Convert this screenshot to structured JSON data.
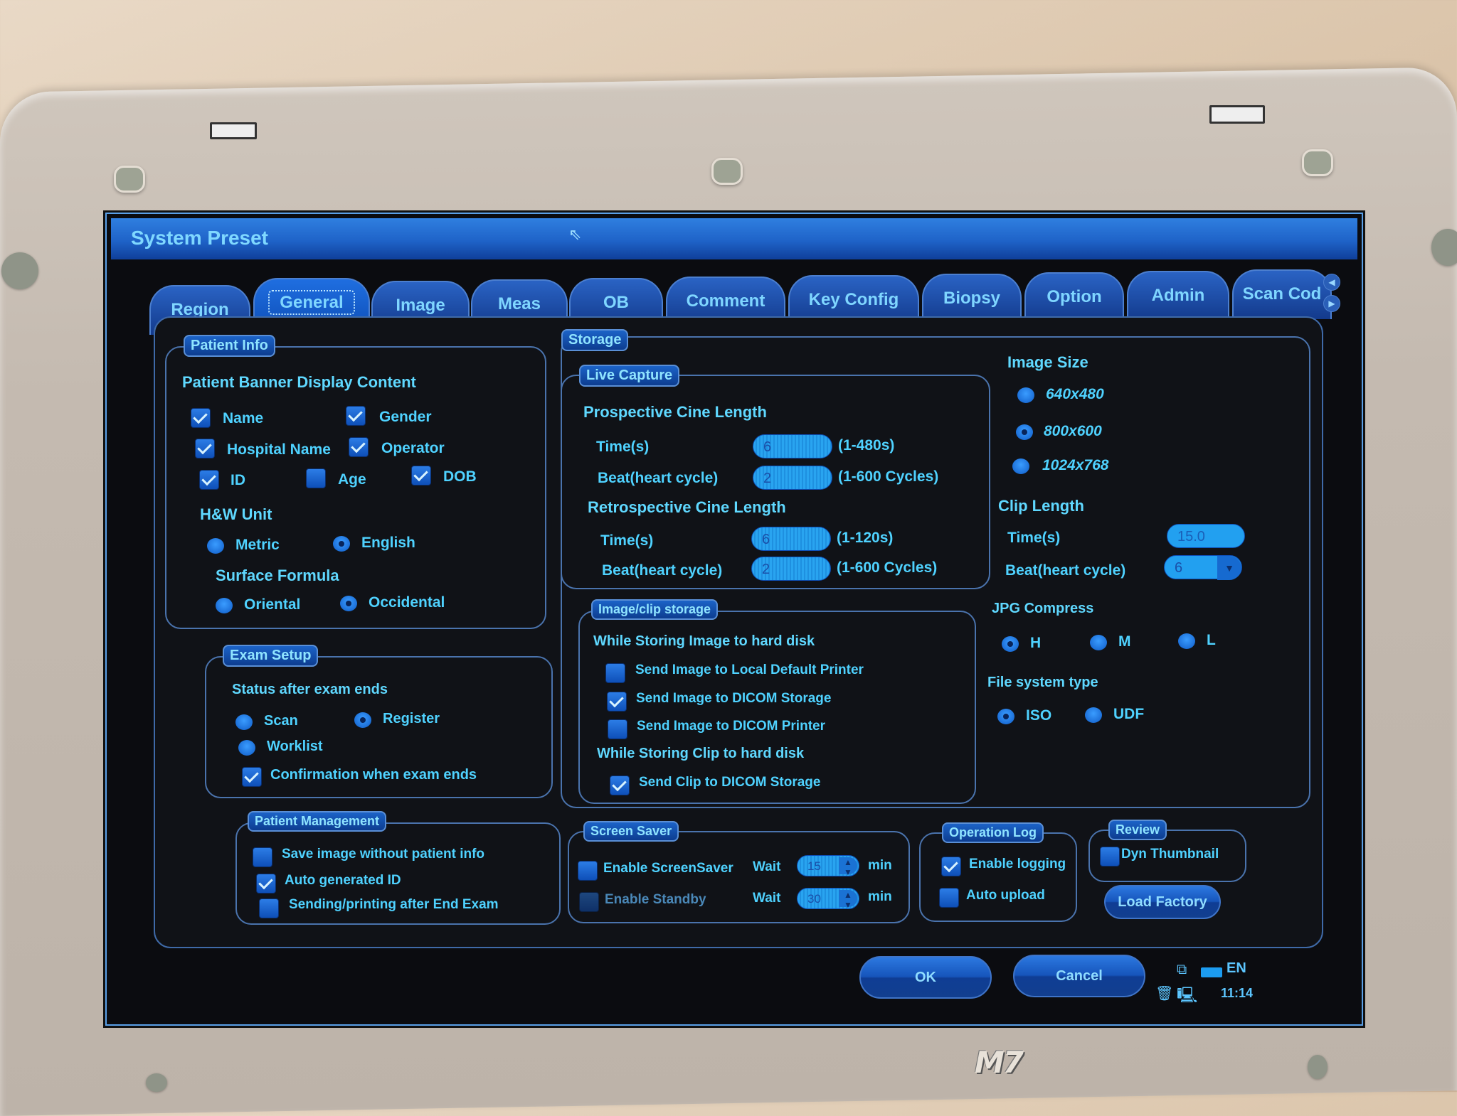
{
  "window": {
    "title": "System Preset"
  },
  "tabs": [
    {
      "label": "Region",
      "active": false
    },
    {
      "label": "General",
      "active": true
    },
    {
      "label": "Image",
      "active": false
    },
    {
      "label": "Meas",
      "active": false
    },
    {
      "label": "OB",
      "active": false
    },
    {
      "label": "Comment",
      "active": false
    },
    {
      "label": "Key Config",
      "active": false
    },
    {
      "label": "Biopsy",
      "active": false
    },
    {
      "label": "Option",
      "active": false
    },
    {
      "label": "Admin",
      "active": false
    },
    {
      "label": "Scan Cod",
      "active": false
    }
  ],
  "patient_info": {
    "legend": "Patient Info",
    "banner_heading": "Patient Banner Display Content",
    "banner_items": [
      {
        "label": "Name",
        "checked": true
      },
      {
        "label": "Gender",
        "checked": true
      },
      {
        "label": "Hospital Name",
        "checked": true
      },
      {
        "label": "Operator",
        "checked": true
      },
      {
        "label": "ID",
        "checked": true
      },
      {
        "label": "Age",
        "checked": false
      },
      {
        "label": "DOB",
        "checked": true
      }
    ],
    "hw_unit_heading": "H&W Unit",
    "hw_unit_options": [
      {
        "label": "Metric",
        "selected": false
      },
      {
        "label": "English",
        "selected": true
      }
    ],
    "surface_heading": "Surface Formula",
    "surface_options": [
      {
        "label": "Oriental",
        "selected": false
      },
      {
        "label": "Occidental",
        "selected": true
      }
    ]
  },
  "exam_setup": {
    "legend": "Exam Setup",
    "status_heading": "Status after exam ends",
    "status_options": [
      {
        "label": "Scan",
        "selected": false
      },
      {
        "label": "Register",
        "selected": true
      },
      {
        "label": "Worklist",
        "selected": false
      }
    ],
    "confirm": {
      "label": "Confirmation when exam ends",
      "checked": true
    }
  },
  "patient_management": {
    "legend": "Patient Management",
    "items": [
      {
        "label": "Save image without patient info",
        "checked": false
      },
      {
        "label": "Auto generated ID",
        "checked": true
      },
      {
        "label": "Sending/printing after End Exam",
        "checked": false
      }
    ]
  },
  "storage": {
    "legend": "Storage",
    "live_capture": {
      "legend": "Live Capture",
      "prospective_heading": "Prospective Cine Length",
      "prospective": [
        {
          "label": "Time(s)",
          "value": "6",
          "range": "(1-480s)"
        },
        {
          "label": "Beat(heart cycle)",
          "value": "2",
          "range": "(1-600 Cycles)"
        }
      ],
      "retrospective_heading": "Retrospective Cine Length",
      "retrospective": [
        {
          "label": "Time(s)",
          "value": "6",
          "range": "(1-120s)"
        },
        {
          "label": "Beat(heart cycle)",
          "value": "2",
          "range": "(1-600 Cycles)"
        }
      ]
    },
    "image_clip": {
      "legend": "Image/clip storage",
      "image_heading": "While Storing Image to hard disk",
      "image_items": [
        {
          "label": "Send Image to Local Default Printer",
          "checked": false
        },
        {
          "label": "Send Image to DICOM Storage",
          "checked": true
        },
        {
          "label": "Send Image to DICOM Printer",
          "checked": false
        }
      ],
      "clip_heading": "While Storing Clip to hard disk",
      "clip_items": [
        {
          "label": "Send Clip to DICOM Storage",
          "checked": true
        }
      ]
    },
    "image_size": {
      "heading": "Image Size",
      "options": [
        {
          "label": "640x480",
          "selected": false
        },
        {
          "label": "800x600",
          "selected": true
        },
        {
          "label": "1024x768",
          "selected": false
        }
      ]
    },
    "clip_length": {
      "heading": "Clip Length",
      "time_label": "Time(s)",
      "time_value": "15.0",
      "beat_label": "Beat(heart cycle)",
      "beat_value": "6"
    },
    "jpg_compress": {
      "heading": "JPG Compress",
      "options": [
        {
          "label": "H",
          "selected": true
        },
        {
          "label": "M",
          "selected": false
        },
        {
          "label": "L",
          "selected": false
        }
      ]
    },
    "file_system": {
      "heading": "File system type",
      "options": [
        {
          "label": "ISO",
          "selected": true
        },
        {
          "label": "UDF",
          "selected": false
        }
      ]
    }
  },
  "screen_saver": {
    "legend": "Screen Saver",
    "rows": [
      {
        "label": "Enable ScreenSaver",
        "checked": false,
        "disabled": false,
        "wait_label": "Wait",
        "wait_value": "15",
        "unit": "min"
      },
      {
        "label": "Enable Standby",
        "checked": false,
        "disabled": true,
        "wait_label": "Wait",
        "wait_value": "30",
        "unit": "min"
      }
    ]
  },
  "operation_log": {
    "legend": "Operation Log",
    "items": [
      {
        "label": "Enable logging",
        "checked": true
      },
      {
        "label": "Auto upload",
        "checked": false
      }
    ]
  },
  "review": {
    "legend": "Review",
    "items": [
      {
        "label": "Dyn Thumbnail",
        "checked": false
      }
    ]
  },
  "buttons": {
    "load_factory": "Load Factory",
    "ok": "OK",
    "cancel": "Cancel"
  },
  "status_bar": {
    "language": "EN",
    "time": "11:14"
  },
  "device": {
    "model": "M7"
  }
}
